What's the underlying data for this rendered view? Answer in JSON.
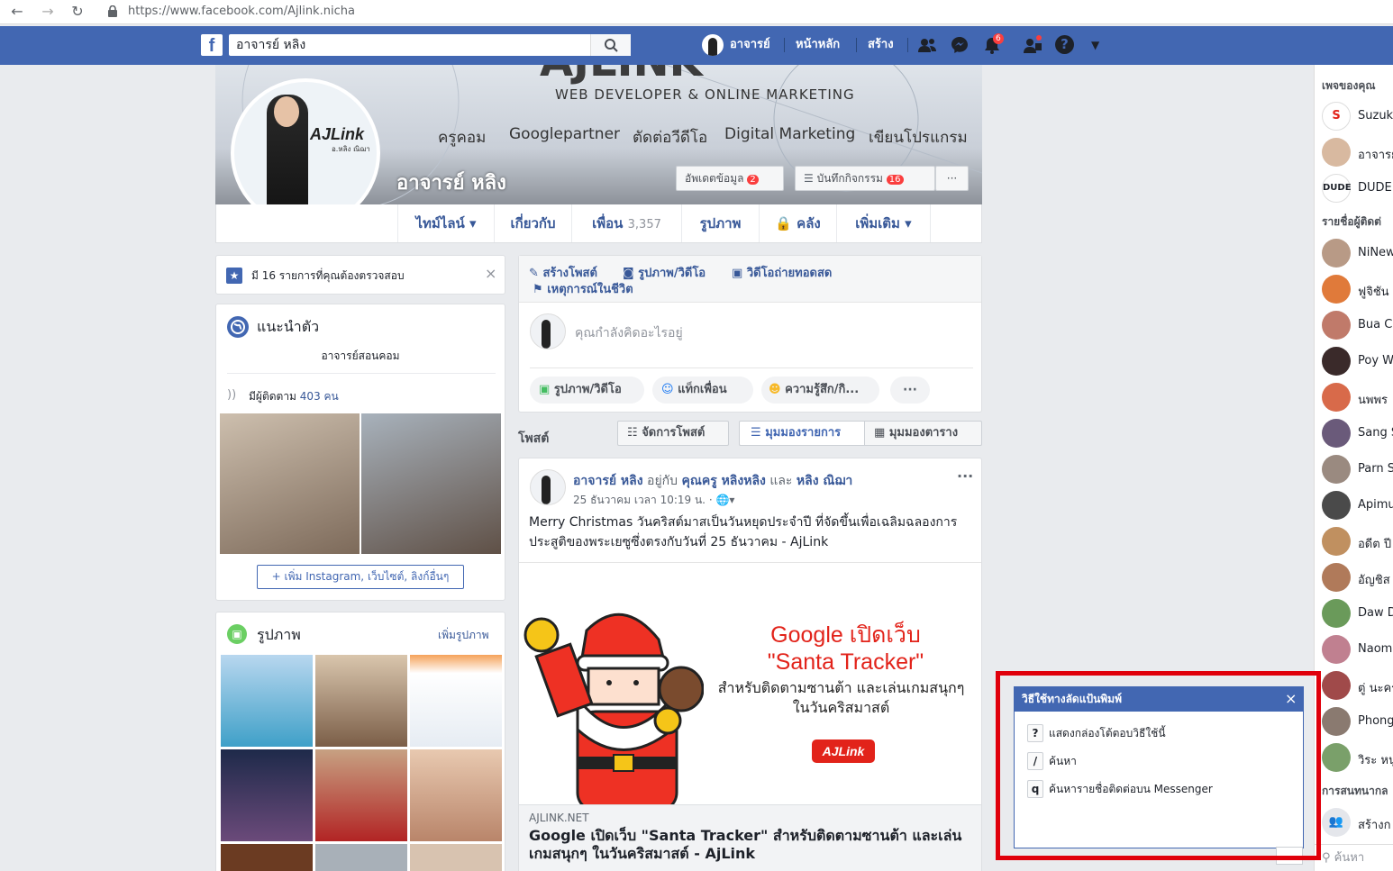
{
  "browser": {
    "url": "https://www.facebook.com/Ajlink.nicha"
  },
  "topbar": {
    "search_value": "อาจารย์ หลิง",
    "profile_name": "อาจารย์",
    "home": "หน้าหลัก",
    "create": "สร้าง",
    "notifications_count": "6"
  },
  "cover": {
    "banner_subtitle": "WEB DEVELOPER & ONLINE MARKETING",
    "menu": [
      "ครูคอม",
      "Googlepartner",
      "ตัดต่อวีดีโอ",
      "Digital Marketing",
      "เขียนโปรแกรม"
    ],
    "profile_logo": "AJLink",
    "profile_logo_sub": "อ.หลิง ณิฌา",
    "name": "อาจารย์ หลิง",
    "update_info": "อัพเดตข้อมูล",
    "update_count": "2",
    "activity_log": "บันทึกกิจกรรม",
    "activity_count": "16",
    "more": "···"
  },
  "tabs": [
    {
      "label": "ไทม์ไลน์ ▾"
    },
    {
      "label": "เกี่ยวกับ"
    },
    {
      "label": "เพื่อน",
      "count": "3,357"
    },
    {
      "label": "รูปภาพ"
    },
    {
      "label": "🔒 คลัง"
    },
    {
      "label": "เพิ่มเติม ▾"
    }
  ],
  "verify": {
    "text": "มี 16 รายการที่คุณต้องตรวจสอบ"
  },
  "intro": {
    "title": "แนะนำตัว",
    "bio": "อาจารย์สอนคอม",
    "followers_prefix": "มีผู้ติดตาม",
    "followers_count": "403 คน",
    "add_links": "+ เพิ่ม Instagram, เว็บไซต์, ลิงก์อื่นๆ"
  },
  "photos": {
    "title": "รูปภาพ",
    "add": "เพิ่มรูปภาพ"
  },
  "composer": {
    "create_post": "สร้างโพสต์",
    "photo_video": "รูปภาพ/วิดีโอ",
    "live_video": "วิดีโอถ่ายทอดสด",
    "life_event": "เหตุการณ์ในชีวิต",
    "placeholder": "คุณกำลังคิดอะไรอยู่",
    "btn_photo": "รูปภาพ/วิดีโอ",
    "btn_tag": "แท็กเพื่อน",
    "btn_feeling": "ความรู้สึก/กิ...",
    "btn_more": "···"
  },
  "posts_bar": {
    "label": "โพสต์",
    "manage": "จัดการโพสต์",
    "list_view": "มุมมองรายการ",
    "grid_view": "มุมมองตาราง"
  },
  "post": {
    "author": "อาจารย์ หลิง",
    "with_text": "อยู่กับ",
    "tagged1": "คุณครู หลิงหลิง",
    "and_text": "และ",
    "tagged2": "หลิง ณิฌา",
    "time": "25 ธันวาคม เวลา 10:19 น. · ",
    "text": "Merry Christmas วันคริสต์มาสเป็นวันหยุดประจำปี ที่จัดขึ้นเพื่อเฉลิมฉลองการประสูติของพระเยซูซึ่งตรงกับวันที่ 25 ธันวาคม - AjLink",
    "image_title_1": "Google เปิดเว็บ",
    "image_title_2": "\"Santa Tracker\"",
    "image_sub_1": "สำหรับติดตามซานต้า และเล่นเกมสนุกๆ",
    "image_sub_2": "ในวันคริสมาสต์",
    "image_logo": "AJLink",
    "link_domain": "AJLINK.NET",
    "link_title": "Google เปิดเว็บ \"Santa Tracker\" สำหรับติดตามซานต้า และเล่นเกมสนุกๆ ในวันคริสมาสต์ - AjLink"
  },
  "right_sidebar": {
    "your_pages": "เพจของคุณ",
    "pages": [
      "Suzuk",
      "อาจารย",
      "DUDE"
    ],
    "contacts": "รายชื่อผู้ติดต่",
    "people": [
      "NiNew",
      "ฟูจิชัน",
      "Bua C",
      "Poy W",
      "นพพร",
      "Sang S",
      "Parn S",
      "Apimu",
      "อดีต ปี",
      "อัญชิส",
      "Daw D",
      "Naomi",
      "ตู่ นะครั",
      "Phong",
      "วิระ หนู"
    ],
    "group_convos": "การสนทนากล",
    "create_group": "สร้างก",
    "search": "ค้นหา"
  },
  "shortcuts": {
    "title": "วิธีใช้ทางลัดแป้นพิมพ์",
    "close": "×",
    "rows": [
      {
        "key": "?",
        "label": "แสดงกล่องโต้ตอบวิธีใช้นี้"
      },
      {
        "key": "/",
        "label": "ค้นหา"
      },
      {
        "key": "q",
        "label": "ค้นหารายชื่อติดต่อบน Messenger"
      }
    ]
  },
  "colors": {
    "fb_blue": "#4267b2",
    "link": "#385898",
    "highlight_red": "#e0000b",
    "badge_red": "#fa3e3e"
  }
}
